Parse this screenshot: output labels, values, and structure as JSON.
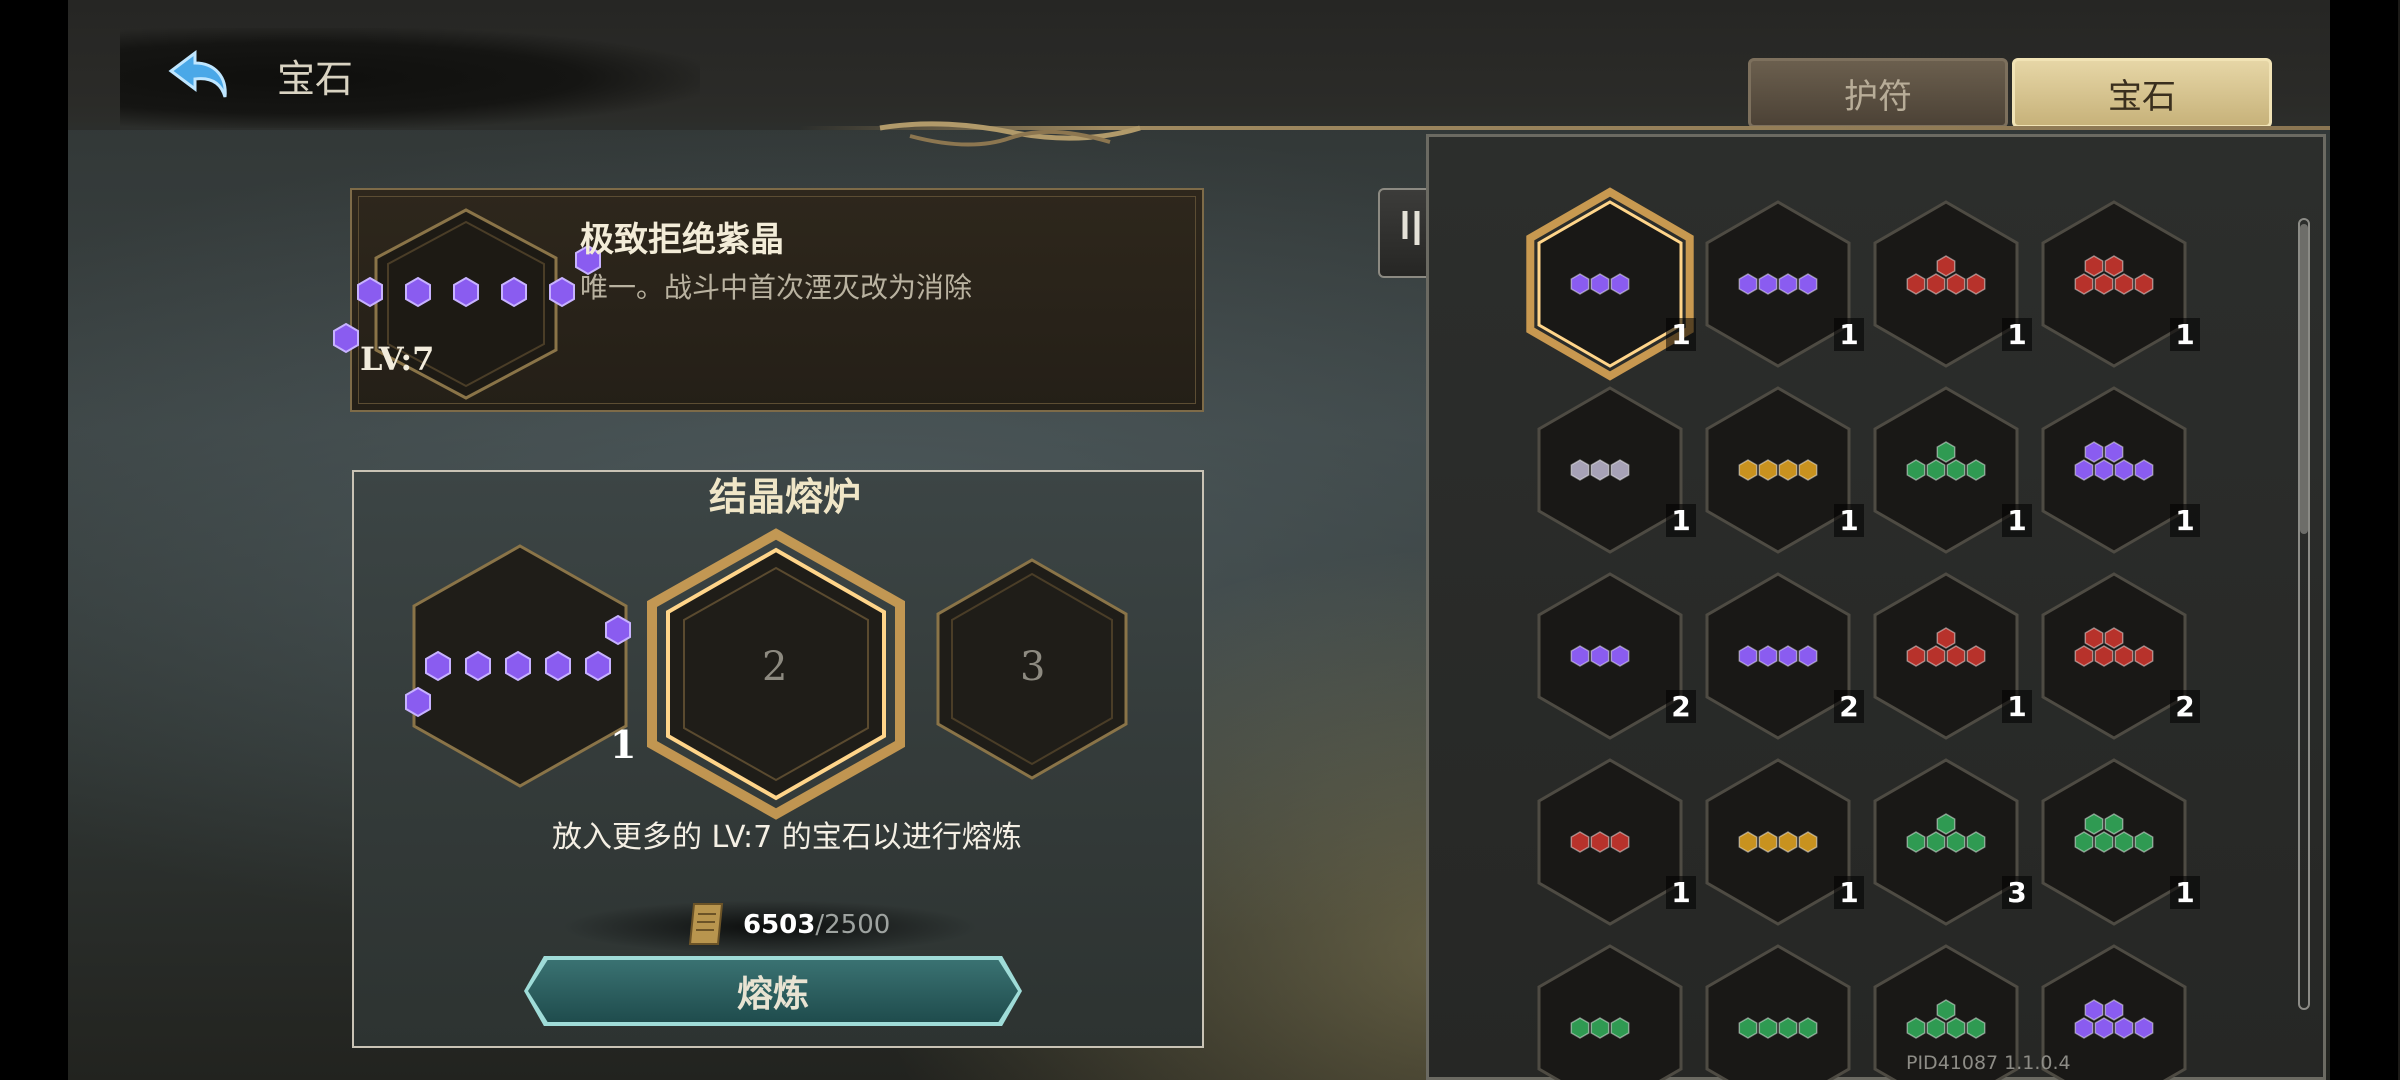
{
  "header": {
    "title": "宝石"
  },
  "tabs": [
    {
      "label": "护符",
      "active": false
    },
    {
      "label": "宝石",
      "active": true
    }
  ],
  "selected_gem": {
    "name": "极致拒绝紫晶",
    "description": "唯一。战斗中首次湮灭改为消除",
    "level": "LV:7"
  },
  "furnace": {
    "title": "结晶熔炉",
    "slots": [
      {
        "label": "",
        "count": "1"
      },
      {
        "label": "2"
      },
      {
        "label": "3"
      }
    ],
    "hint": "放入更多的 LV:7 的宝石以进行熔炼",
    "cost_current": "6503",
    "cost_max": "/2500",
    "button_label": "熔炼"
  },
  "inventory": {
    "items": [
      {
        "color": "purple",
        "count": "1",
        "selected": true
      },
      {
        "color": "purple",
        "count": "1"
      },
      {
        "color": "red",
        "count": "1"
      },
      {
        "color": "red",
        "count": "1"
      },
      {
        "color": "gray",
        "count": "1"
      },
      {
        "color": "gold",
        "count": "1"
      },
      {
        "color": "green",
        "count": "1"
      },
      {
        "color": "purple",
        "count": "1"
      },
      {
        "color": "purple",
        "count": "2"
      },
      {
        "color": "purple",
        "count": "2"
      },
      {
        "color": "red",
        "count": "1"
      },
      {
        "color": "red",
        "count": "2"
      },
      {
        "color": "red",
        "count": "1"
      },
      {
        "color": "gold",
        "count": "1"
      },
      {
        "color": "green",
        "count": "3"
      },
      {
        "color": "green",
        "count": "1"
      },
      {
        "color": "green",
        "count": ""
      },
      {
        "color": "green",
        "count": ""
      },
      {
        "color": "green",
        "count": ""
      },
      {
        "color": "purple",
        "count": ""
      }
    ]
  },
  "colors": {
    "purple": "#8a5cf0",
    "red": "#b7322b",
    "green": "#2f9a52",
    "gold": "#c8921f",
    "gray": "#a7a2b6",
    "selected_glow": "#f0b45a"
  },
  "version": "PID41087  1.1.0.4"
}
